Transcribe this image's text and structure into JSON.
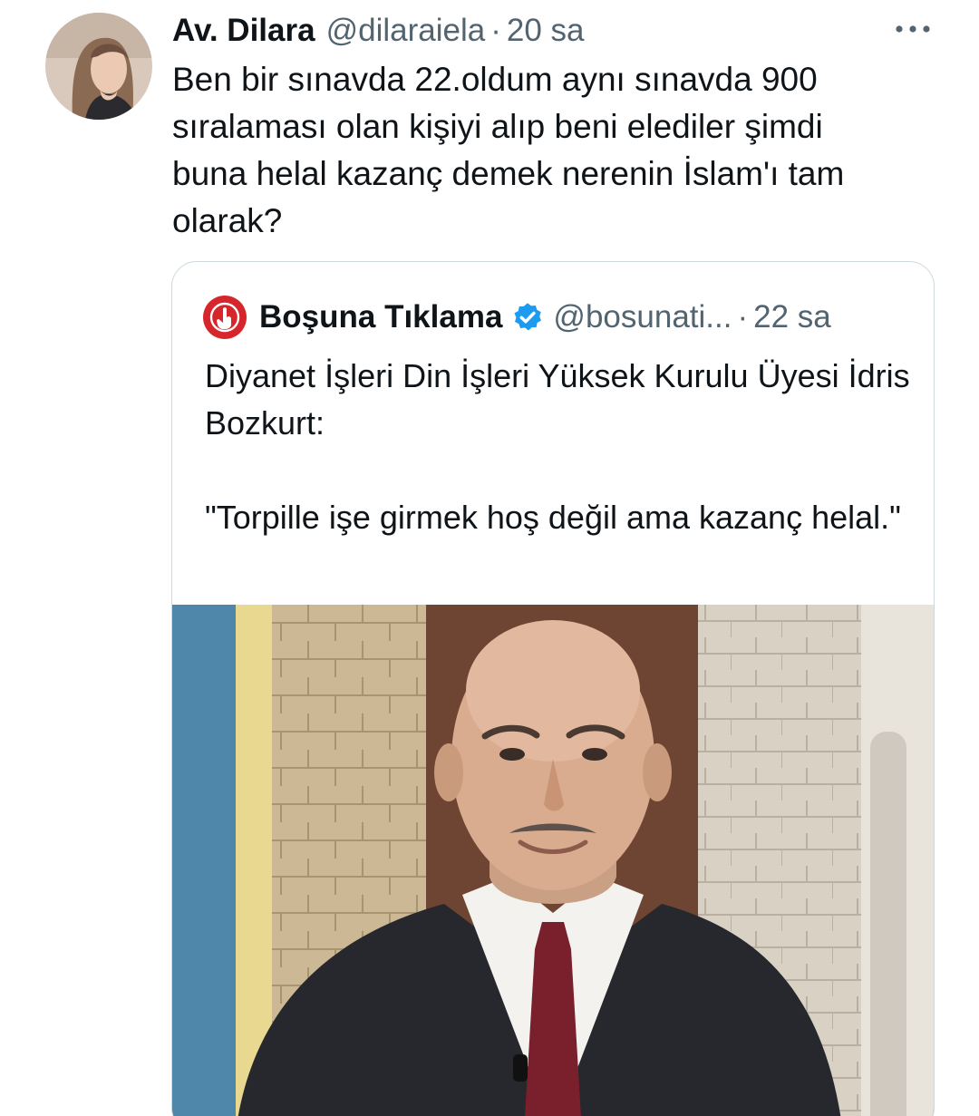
{
  "tweet": {
    "author_name": "Av. Dilara",
    "author_handle": "@dilaraiela",
    "separator": "·",
    "time": "20 sa",
    "text": "Ben bir sınavda 22.oldum aynı sınavda 900\nsıralaması olan kişiyi alıp beni elediler şimdi\nbuna helal kazanç demek nerenin İslam'ı tam\nolarak?",
    "more_icon": "more-horizontal-icon"
  },
  "quote": {
    "author_name": "Boşuna Tıklama",
    "author_handle": "@bosunati...",
    "separator": "·",
    "time": "22 sa",
    "verified_icon": "verified-badge-icon",
    "verified_color": "#1d9bf0",
    "brand_color": "#d7262b",
    "text_lines": [
      "Diyanet İşleri Din İşleri Yüksek Kurulu Üyesi İdris Bozkurt:",
      "\"Torpille işe girmek hoş değil ama kazanç helal.\""
    ]
  },
  "colors": {
    "primary_text": "#0f1419",
    "secondary_text": "#536471",
    "border": "#cfd9de"
  }
}
